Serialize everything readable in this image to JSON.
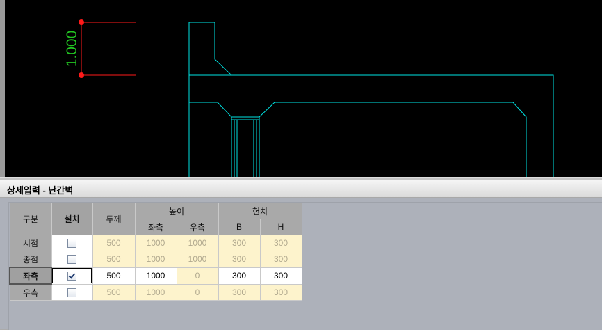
{
  "cad": {
    "dimension_label": "1.000",
    "colors": {
      "background": "#000000",
      "outline": "#00e5e5",
      "dimension": "#ff1a1a",
      "dimension_text": "#22c522"
    }
  },
  "panel": {
    "title": "상세입력 - 난간벽"
  },
  "table": {
    "headers": {
      "category": "구분",
      "install": "설치",
      "thickness": "두께",
      "height": "높이",
      "height_left": "좌측",
      "height_right": "우측",
      "haunch": "헌치",
      "haunch_b": "B",
      "haunch_h": "H"
    },
    "rows": [
      {
        "label": "시점",
        "installed": false,
        "thickness": "500",
        "height_left": "1000",
        "height_right": "1000",
        "b": "300",
        "h": "300",
        "enabled": false
      },
      {
        "label": "종점",
        "installed": false,
        "thickness": "500",
        "height_left": "1000",
        "height_right": "1000",
        "b": "300",
        "h": "300",
        "enabled": false
      },
      {
        "label": "좌측",
        "installed": true,
        "thickness": "500",
        "height_left": "1000",
        "height_right": "0",
        "b": "300",
        "h": "300",
        "enabled": true
      },
      {
        "label": "우측",
        "installed": false,
        "thickness": "500",
        "height_left": "1000",
        "height_right": "0",
        "b": "300",
        "h": "300",
        "enabled": false
      }
    ]
  }
}
